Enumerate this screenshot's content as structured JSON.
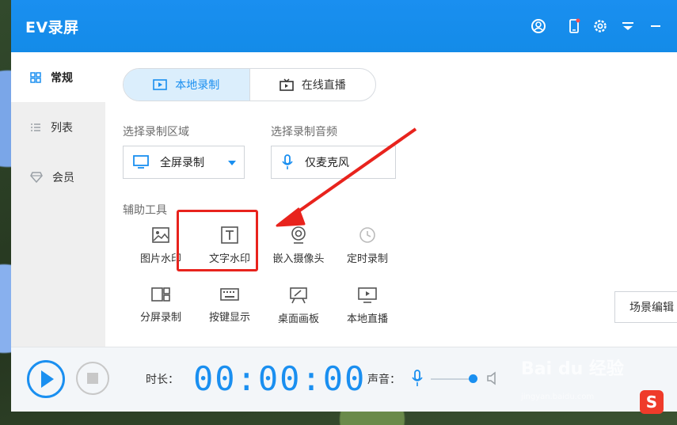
{
  "app": {
    "title": "EV录屏"
  },
  "titlebar_icons": [
    "user-icon",
    "phone-icon",
    "settings-icon",
    "dropdown-icon",
    "minimize-icon"
  ],
  "sidebar": {
    "items": [
      {
        "label": "常规",
        "icon": "grid-icon",
        "active": true
      },
      {
        "label": "列表",
        "icon": "list-icon",
        "active": false
      },
      {
        "label": "会员",
        "icon": "diamond-icon",
        "active": false
      }
    ]
  },
  "mode_tabs": [
    {
      "label": "本地录制",
      "active": true
    },
    {
      "label": "在线直播",
      "active": false
    }
  ],
  "record_area": {
    "label": "选择录制区域",
    "value": "全屏录制"
  },
  "record_audio": {
    "label": "选择录制音频",
    "value": "仅麦克风"
  },
  "tools": {
    "label": "辅助工具",
    "items": [
      {
        "label": "图片水印",
        "icon": "image-icon"
      },
      {
        "label": "文字水印",
        "icon": "text-icon"
      },
      {
        "label": "嵌入摄像头",
        "icon": "camera-icon"
      },
      {
        "label": "定时录制",
        "icon": "clock-icon"
      },
      {
        "label": "分屏录制",
        "icon": "split-icon"
      },
      {
        "label": "按键显示",
        "icon": "keyboard-icon"
      },
      {
        "label": "桌面画板",
        "icon": "easel-icon"
      },
      {
        "label": "本地直播",
        "icon": "monitor-play-icon"
      }
    ]
  },
  "scene_edit": {
    "label": "场景编辑"
  },
  "bottom": {
    "duration_label": "时长：",
    "timer": "00:00:00",
    "sound_label": "声音：",
    "volume": 0.9
  },
  "watermark": {
    "brand": "Bai du 经验",
    "url": "jingyan.baidu.com"
  },
  "colors": {
    "accent": "#1a8ff0",
    "highlight": "#e8231d"
  }
}
